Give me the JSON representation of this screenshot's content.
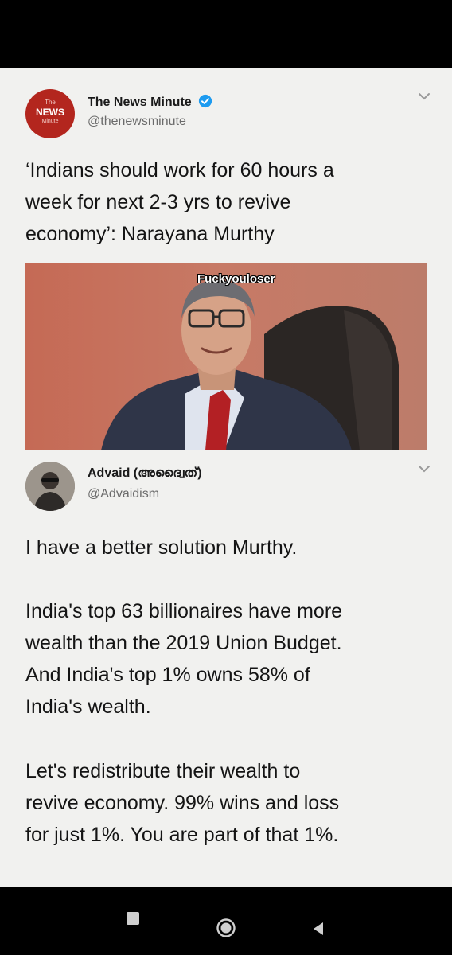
{
  "tweet1": {
    "account_name": "The News Minute",
    "handle": "@thenewsminute",
    "avatar": {
      "top_text": "The",
      "main_text": "NEWS",
      "sub_text": "Minute"
    },
    "text_lines": [
      "‘Indians should work for 60 hours a",
      "week for next 2-3 yrs to revive",
      "economy’: Narayana Murthy"
    ],
    "image_caption": "Fuckyouloser",
    "verified": true
  },
  "tweet2": {
    "account_name": "Advaid (അദ്വൈത്)",
    "handle": "@Advaidism",
    "paragraphs": [
      [
        "I have a better solution Murthy."
      ],
      [
        "India's top 63 billionaires have more",
        "wealth than the 2019 Union Budget.",
        "And India's top 1% owns 58% of",
        "India's wealth."
      ],
      [
        "Let's redistribute their wealth to",
        "revive economy. 99% wins and loss",
        "for just 1%. You are part of that 1%."
      ]
    ]
  },
  "navbar": {
    "buttons": [
      "recent-apps",
      "home",
      "back"
    ]
  },
  "colors": {
    "background": "#f1f1ef",
    "verified_blue": "#1d9bf0",
    "tnm_red": "#b3261e"
  }
}
